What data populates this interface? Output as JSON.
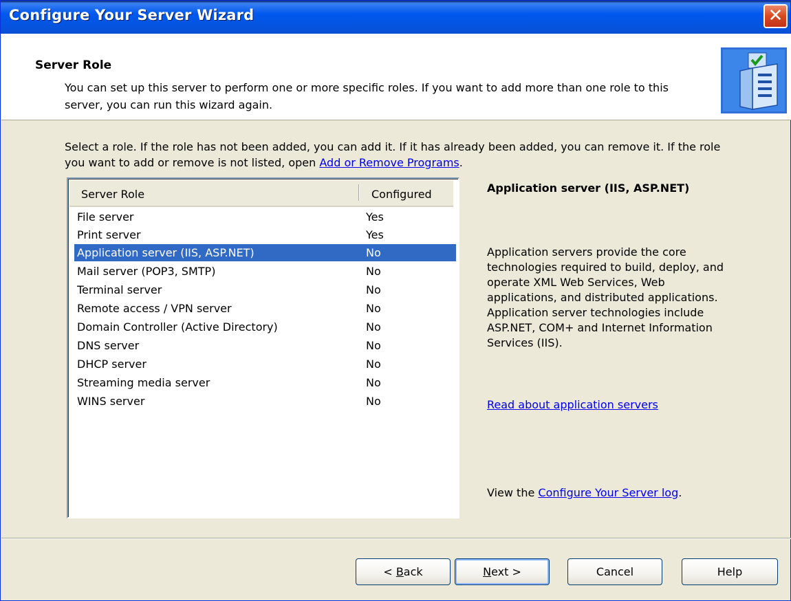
{
  "window": {
    "title": "Configure Your Server Wizard",
    "close_glyph": "✕"
  },
  "header": {
    "title": "Server Role",
    "description": "You can set up this server to perform one or more specific roles. If you want to add more than one role to this server, you can run this wizard again."
  },
  "instructions": {
    "text": "Select a role. If the role has not been added, you can add it. If it has already been added, you can remove it. If the role you want to add or remove is not listed, open ",
    "link": "Add or Remove Programs",
    "suffix": "."
  },
  "table": {
    "columns": [
      "Server Role",
      "Configured"
    ],
    "rows": [
      {
        "role": "File server",
        "configured": "Yes"
      },
      {
        "role": "Print server",
        "configured": "Yes"
      },
      {
        "role": "Application server (IIS, ASP.NET)",
        "configured": "No",
        "selected": true
      },
      {
        "role": "Mail server (POP3, SMTP)",
        "configured": "No"
      },
      {
        "role": "Terminal server",
        "configured": "No"
      },
      {
        "role": "Remote access / VPN server",
        "configured": "No"
      },
      {
        "role": "Domain Controller (Active Directory)",
        "configured": "No"
      },
      {
        "role": "DNS server",
        "configured": "No"
      },
      {
        "role": "DHCP server",
        "configured": "No"
      },
      {
        "role": "Streaming media server",
        "configured": "No"
      },
      {
        "role": "WINS server",
        "configured": "No"
      }
    ]
  },
  "detail": {
    "title": "Application server (IIS, ASP.NET)",
    "description": "Application servers provide the core technologies required to build, deploy, and operate XML Web Services, Web applications, and distributed applications. Application server technologies include ASP.NET, COM+ and Internet Information Services (IIS).",
    "read_link": "Read about application servers",
    "log_prefix": "View the ",
    "log_link": "Configure Your Server log",
    "log_suffix": "."
  },
  "buttons": {
    "back_prefix": "< ",
    "back_key": "B",
    "back_rest": "ack",
    "next_key": "N",
    "next_rest": "ext >",
    "cancel": "Cancel",
    "help": "Help"
  },
  "icons": {
    "wizard": "server-checklist-icon",
    "close": "close-icon"
  },
  "colors": {
    "titlebar": "#0058ee",
    "selection": "#316ac5",
    "link": "#0000ee",
    "dialog_bg": "#ece9d8"
  }
}
